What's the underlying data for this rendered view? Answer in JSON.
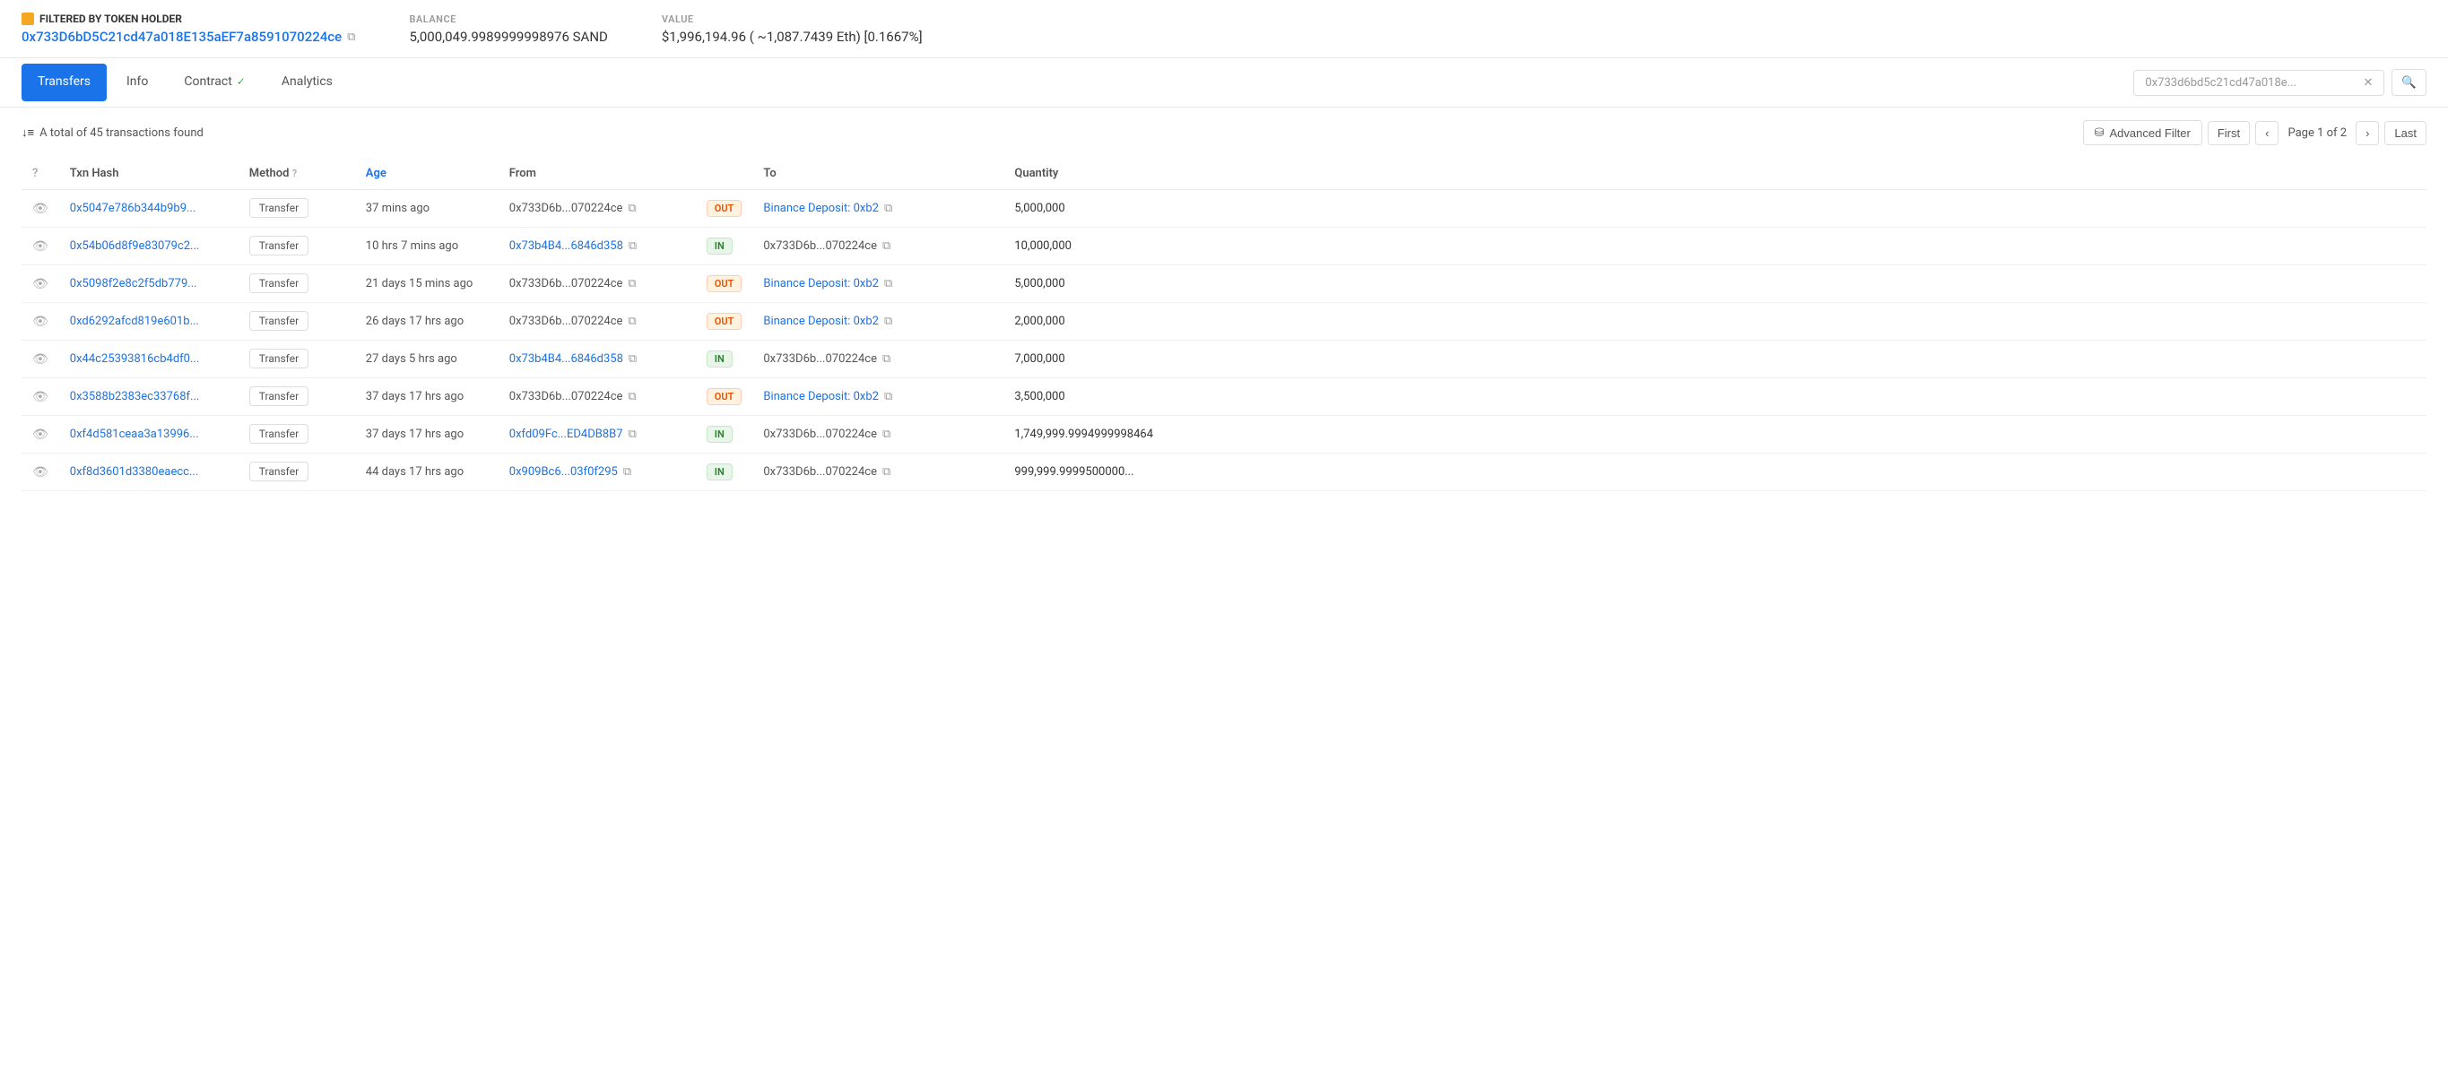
{
  "banner": {
    "label_token": "FILTERED BY TOKEN HOLDER",
    "address": "0x733D6bD5C21cd47a018E135aEF7a8591070224ce",
    "balance_label": "BALANCE",
    "balance_value": "5,000,049.9989999998976 SAND",
    "value_label": "VALUE",
    "value_text": "$1,996,194.96 ( ~1,087.7439 Eth) [0.1667%]"
  },
  "tabs": {
    "transfers_label": "Transfers",
    "info_label": "Info",
    "contract_label": "Contract",
    "analytics_label": "Analytics",
    "search_placeholder": "0x733d6bd5c21cd47a018e...",
    "search_close": "✕"
  },
  "filter": {
    "sort_icon": "↓≡",
    "count_text": "A total of 45 transactions found",
    "adv_filter_label": "Advanced Filter",
    "first_label": "First",
    "prev_label": "‹",
    "page_info": "Page 1 of 2",
    "next_label": "›",
    "last_label": "Last"
  },
  "table": {
    "col_txn": "Txn Hash",
    "col_method": "Method",
    "col_method_help": "?",
    "col_age": "Age",
    "col_from": "From",
    "col_to": "To",
    "col_qty": "Quantity"
  },
  "rows": [
    {
      "txn": "0x5047e786b344b9b9...",
      "method": "Transfer",
      "age": "37 mins ago",
      "from": "0x733D6b...070224ce",
      "from_type": "normal",
      "direction": "OUT",
      "to": "Binance Deposit: 0xb2",
      "to_type": "label",
      "qty": "5,000,000"
    },
    {
      "txn": "0x54b06d8f9e83079c2...",
      "method": "Transfer",
      "age": "10 hrs 7 mins ago",
      "from": "0x73b4B4...6846d358",
      "from_type": "link",
      "direction": "IN",
      "to": "0x733D6b...070224ce",
      "to_type": "normal",
      "qty": "10,000,000"
    },
    {
      "txn": "0x5098f2e8c2f5db779...",
      "method": "Transfer",
      "age": "21 days 15 mins ago",
      "from": "0x733D6b...070224ce",
      "from_type": "normal",
      "direction": "OUT",
      "to": "Binance Deposit: 0xb2",
      "to_type": "label",
      "qty": "5,000,000"
    },
    {
      "txn": "0xd6292afcd819e601b...",
      "method": "Transfer",
      "age": "26 days 17 hrs ago",
      "from": "0x733D6b...070224ce",
      "from_type": "normal",
      "direction": "OUT",
      "to": "Binance Deposit: 0xb2",
      "to_type": "label",
      "qty": "2,000,000"
    },
    {
      "txn": "0x44c25393816cb4df0...",
      "method": "Transfer",
      "age": "27 days 5 hrs ago",
      "from": "0x73b4B4...6846d358",
      "from_type": "link",
      "direction": "IN",
      "to": "0x733D6b...070224ce",
      "to_type": "normal",
      "qty": "7,000,000"
    },
    {
      "txn": "0x3588b2383ec33768f...",
      "method": "Transfer",
      "age": "37 days 17 hrs ago",
      "from": "0x733D6b...070224ce",
      "from_type": "normal",
      "direction": "OUT",
      "to": "Binance Deposit: 0xb2",
      "to_type": "label",
      "qty": "3,500,000"
    },
    {
      "txn": "0xf4d581ceaa3a13996...",
      "method": "Transfer",
      "age": "37 days 17 hrs ago",
      "from": "0xfd09Fc...ED4DB8B7",
      "from_type": "link",
      "direction": "IN",
      "to": "0x733D6b...070224ce",
      "to_type": "normal",
      "qty": "1,749,999.9994999998464"
    },
    {
      "txn": "0xf8d3601d3380eaecc...",
      "method": "Transfer",
      "age": "44 days 17 hrs ago",
      "from": "0x909Bc6...03f0f295",
      "from_type": "link",
      "direction": "IN",
      "to": "0x733D6b...070224ce",
      "to_type": "normal",
      "qty": "999,999.9999500000..."
    }
  ]
}
